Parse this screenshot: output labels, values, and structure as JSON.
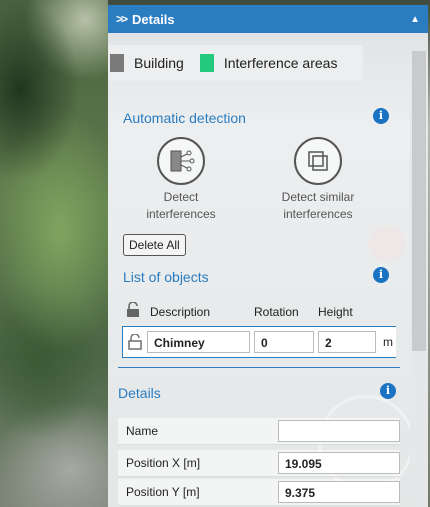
{
  "panel": {
    "title": "Details"
  },
  "legend": [
    {
      "label": "Building",
      "color": "#7a7a7a"
    },
    {
      "label": "Interference areas",
      "color": "#23c97c"
    }
  ],
  "automatic_detection": {
    "title": "Automatic detection",
    "detect_label_1": "Detect",
    "detect_label_2": "interferences",
    "similar_label_1": "Detect similar",
    "similar_label_2": "interferences",
    "delete_all": "Delete All"
  },
  "list_of_objects": {
    "title": "List of objects",
    "columns": {
      "description": "Description",
      "rotation": "Rotation",
      "height": "Height"
    },
    "row": {
      "description": "Chimney",
      "rotation": "0",
      "height": "2",
      "unit": "m"
    }
  },
  "details": {
    "title": "Details",
    "name_label": "Name",
    "name_value": "",
    "pos_x_label": "Position X [m]",
    "pos_x_value": "19.095",
    "pos_y_label": "Position Y [m]",
    "pos_y_value": "9.375"
  },
  "colors": {
    "accent": "#2a7dc1",
    "info": "#1a73c2"
  }
}
